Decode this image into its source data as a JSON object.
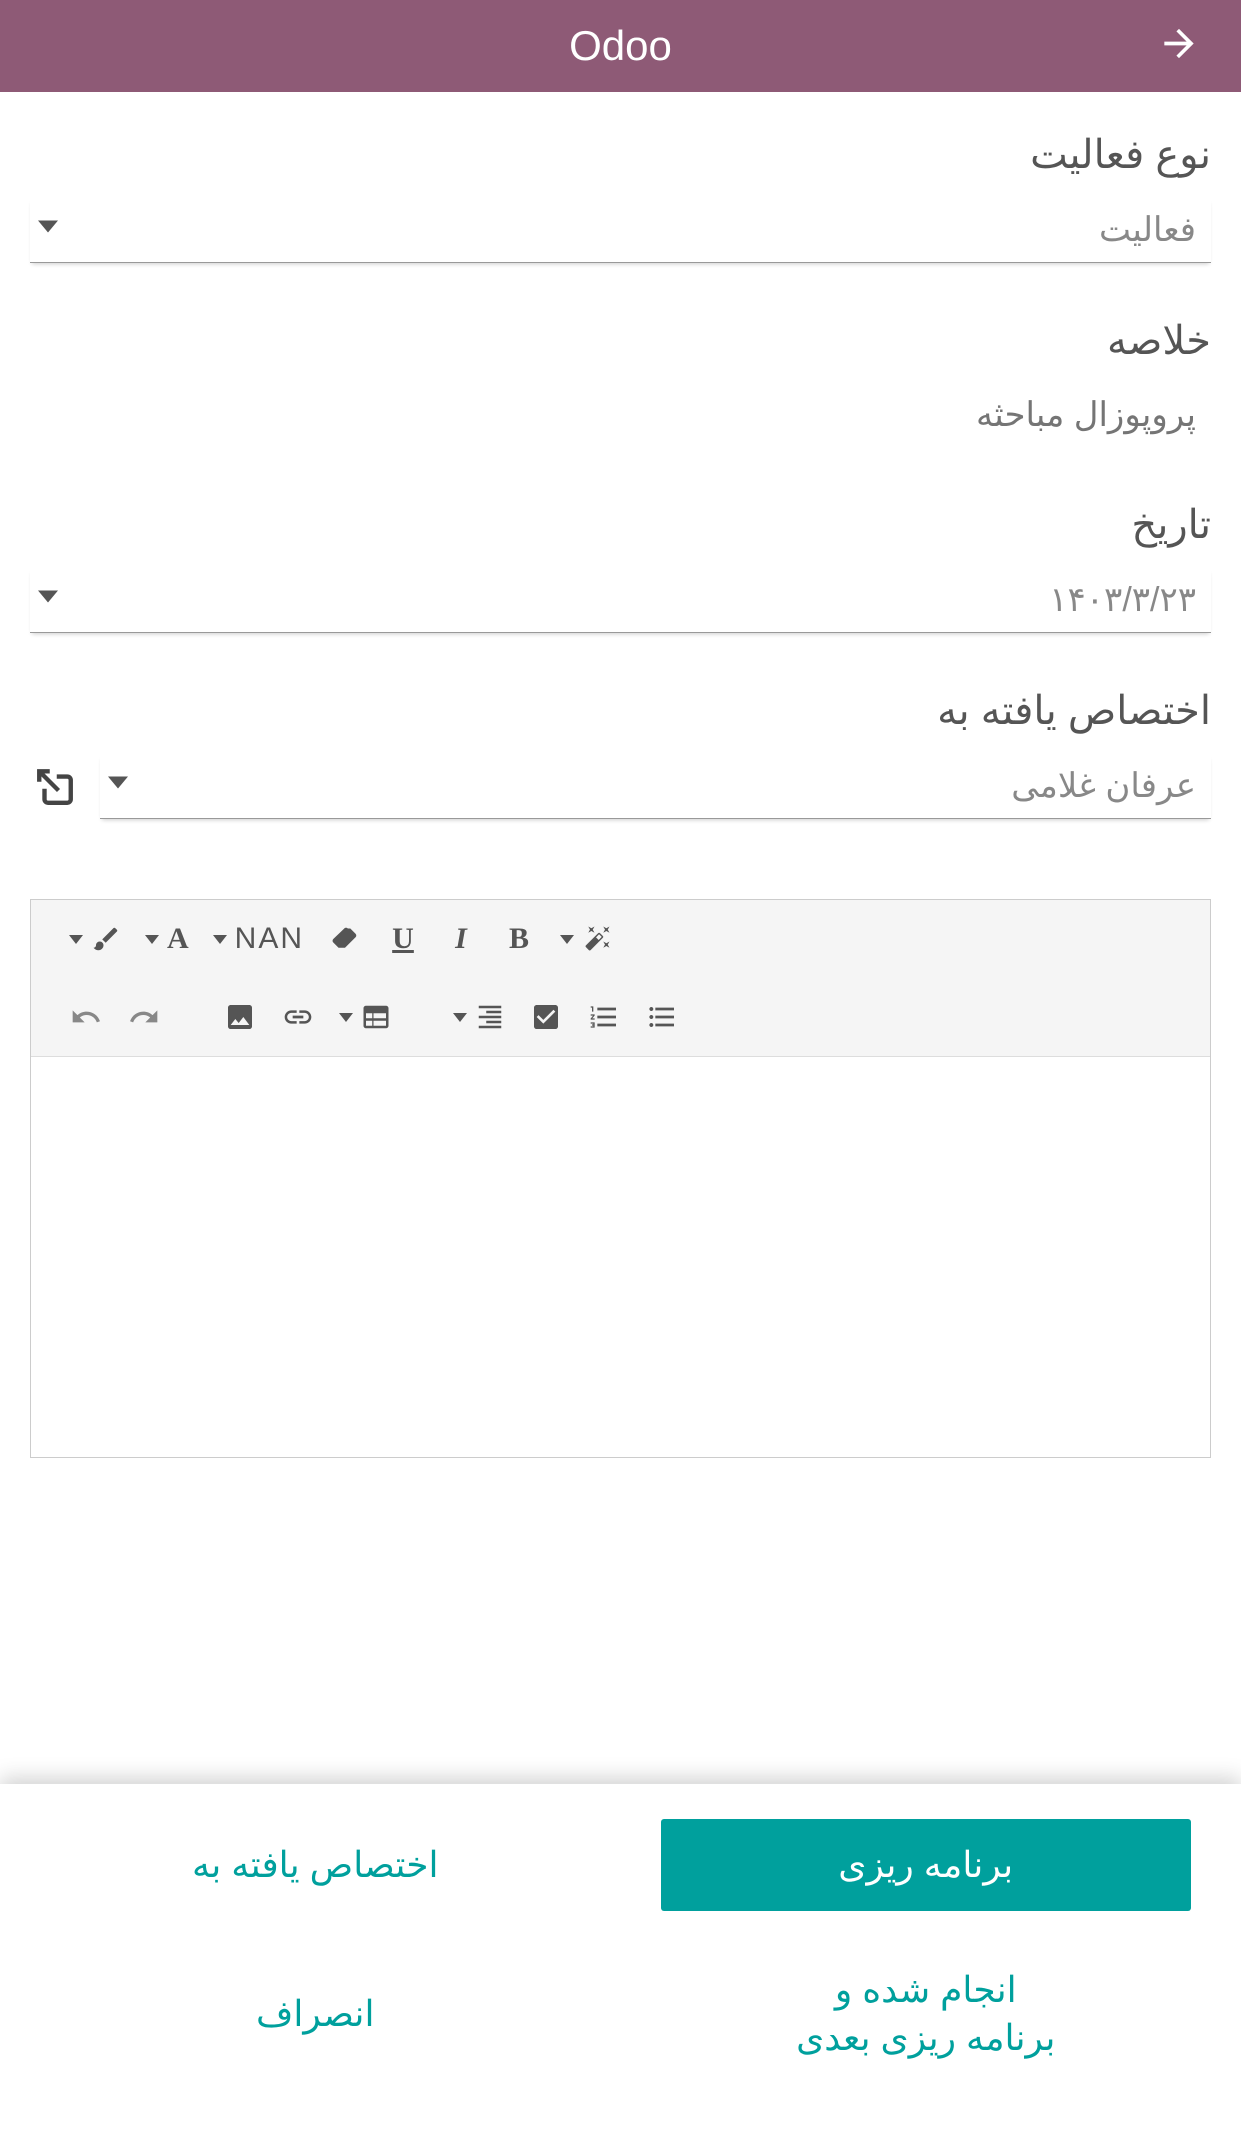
{
  "header": {
    "title": "Odoo"
  },
  "fields": {
    "activity_type": {
      "label": "نوع فعالیت",
      "value": "فعالیت"
    },
    "summary": {
      "label": "خلاصه",
      "placeholder": "پروپوزال مباحثه"
    },
    "date": {
      "label": "تاریخ",
      "value": "۱۴۰۳/۳/۲۳"
    },
    "assigned_to": {
      "label": "اختصاص یافته به",
      "value": "عرفان غلامی"
    }
  },
  "editor": {
    "font_label": "NAN"
  },
  "buttons": {
    "plan": "برنامه ریزی",
    "assigned": "اختصاص یافته به",
    "done_next": "انجام شده و\nبرنامه ریزی بعدی",
    "cancel": "انصراف"
  },
  "icons": {
    "arrow": "arrow-right",
    "external": "external-link"
  }
}
